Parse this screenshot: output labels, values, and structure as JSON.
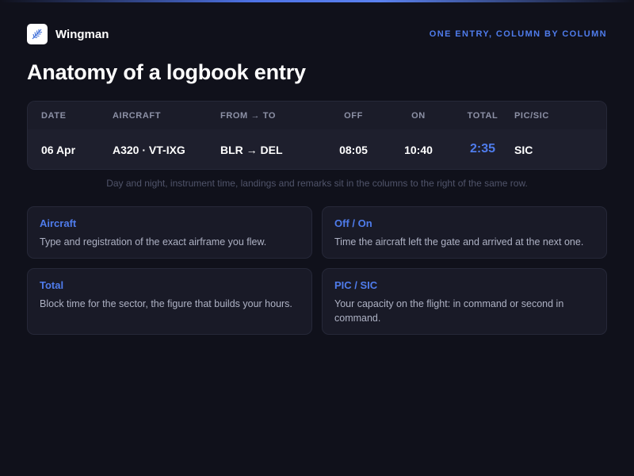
{
  "app": {
    "name": "Wingman",
    "tagline": "ONE ENTRY, COLUMN BY COLUMN",
    "logo_icon": "feather-icon"
  },
  "page": {
    "title": "Anatomy of a logbook entry"
  },
  "table": {
    "headers": {
      "date": "DATE",
      "aircraft": "AIRCRAFT",
      "route": "FROM → TO",
      "off": "OFF",
      "on": "ON",
      "total": "TOTAL",
      "pic": "PIC/SIC"
    },
    "row": {
      "date": "06 Apr",
      "aircraft": "A320 · VT-IXG",
      "route": "BLR → DEL",
      "off": "08:05",
      "on": "10:40",
      "total": "2:35",
      "pic": "SIC"
    }
  },
  "note": "Day and night, instrument time, landings and remarks sit in the columns to the right of the same row.",
  "cards": [
    {
      "title": "Aircraft",
      "text": "Type and registration of the exact airframe you flew."
    },
    {
      "title": "Off / On",
      "text": "Time the aircraft left the gate and arrived at the next one."
    },
    {
      "title": "Total",
      "text": "Block time for the sector, the figure that builds your hours."
    },
    {
      "title": "PIC / SIC",
      "text": "Your capacity on the flight: in command or second in command."
    }
  ],
  "colors": {
    "background": "#10111b",
    "accent": "#4f7cec",
    "panel": "#191a27"
  }
}
